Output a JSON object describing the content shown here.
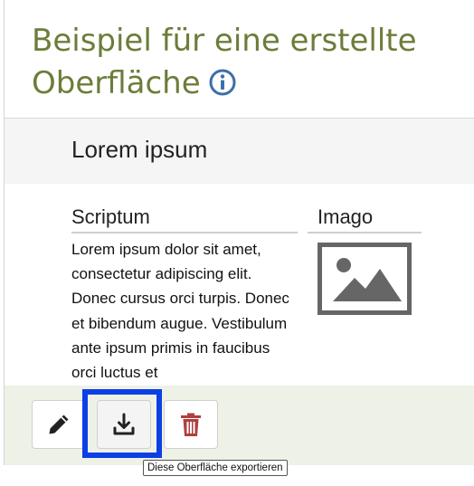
{
  "page": {
    "title": "Beispiel für eine erstellte Oberfläche",
    "info_icon": "info-circle-icon"
  },
  "card": {
    "heading": "Lorem ipsum",
    "columns": {
      "script_heading": "Scriptum",
      "image_heading": "Imago"
    },
    "body_text": "Lorem ipsum dolor sit amet, consectetur adipiscing elit. Donec cursus orci turpis. Donec et bibendum augue. Vestibulum ante ipsum primis in faucibus orci luctus et",
    "image_icon": "image-placeholder-icon"
  },
  "toolbar": {
    "buttons": [
      {
        "icon": "pencil-icon",
        "action": "edit"
      },
      {
        "icon": "download-icon",
        "action": "export"
      },
      {
        "icon": "trash-icon",
        "action": "delete"
      }
    ],
    "tooltip": "Diese Oberfläche exportieren"
  },
  "colors": {
    "title": "#6b7d3a",
    "info_icon": "#3d6fa8",
    "toolbar_background": "#eef1e6",
    "delete_icon": "#b04040",
    "focus_ring": "#0d3fe6"
  }
}
